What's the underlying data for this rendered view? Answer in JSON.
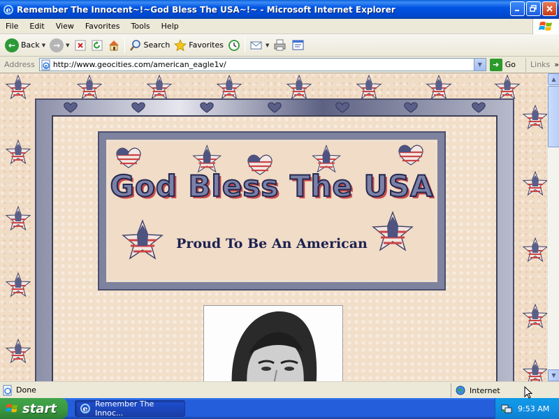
{
  "window": {
    "title": "Remember The Innocent~!~God Bless The USA~!~ - Microsoft Internet Explorer"
  },
  "menu": [
    "File",
    "Edit",
    "View",
    "Favorites",
    "Tools",
    "Help"
  ],
  "toolbar": {
    "back_label": "Back",
    "search_label": "Search",
    "favorites_label": "Favorites"
  },
  "address": {
    "label": "Address",
    "url": "http://www.geocities.com/american_eagle1v/",
    "go_label": "Go",
    "links_label": "Links"
  },
  "page": {
    "banner_title": "God Bless The USA",
    "banner_subtitle": "Proud To Be An American"
  },
  "status": {
    "text": "Done",
    "zone": "Internet"
  },
  "taskbar": {
    "start_label": "start",
    "task_label": "Remember The Innoc...",
    "clock": "9:53 AM"
  },
  "colors": {
    "xp_blue": "#0054e3",
    "start_green": "#3c9a42",
    "banner_navy": "#1e2150",
    "flag_red": "#c94a4a"
  }
}
